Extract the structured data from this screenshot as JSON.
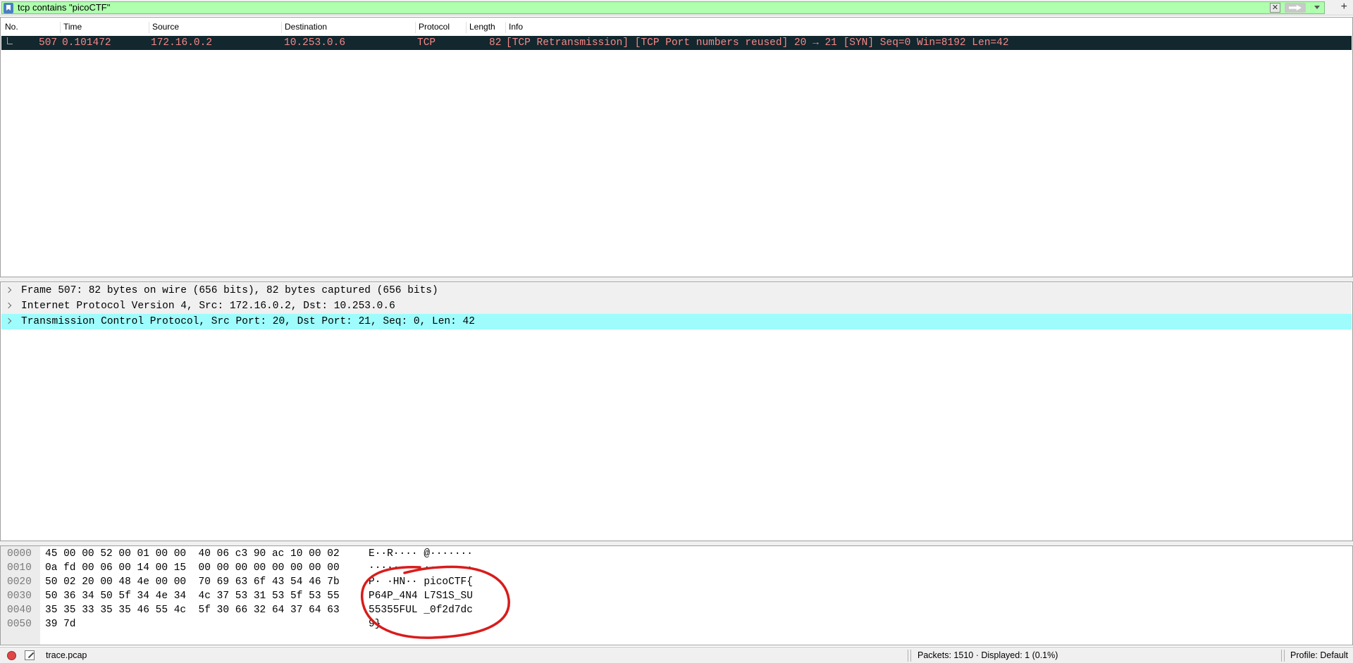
{
  "filter": {
    "value": "tcp contains \"picoCTF\"",
    "clear_symbol": "✕",
    "add_symbol": "+"
  },
  "packet_list": {
    "columns": [
      "No.",
      "Time",
      "Source",
      "Destination",
      "Protocol",
      "Length",
      "Info"
    ],
    "rows": [
      {
        "no": "507",
        "time": "0.101472",
        "source": "172.16.0.2",
        "destination": "10.253.0.6",
        "protocol": "TCP",
        "length": "82",
        "info": "[TCP Retransmission] [TCP Port numbers reused] 20 → 21 [SYN] Seq=0 Win=8192 Len=42"
      }
    ]
  },
  "details": {
    "items": [
      "Frame 507: 82 bytes on wire (656 bits), 82 bytes captured (656 bits)",
      "Internet Protocol Version 4, Src: 172.16.0.2, Dst: 10.253.0.6",
      "Transmission Control Protocol, Src Port: 20, Dst Port: 21, Seq: 0, Len: 42"
    ],
    "selected_index": 2
  },
  "bytes": {
    "rows": [
      {
        "offset": "0000",
        "hex": "45 00 00 52 00 01 00 00  40 06 c3 90 ac 10 00 02",
        "ascii": "E··R···· @·······"
      },
      {
        "offset": "0010",
        "hex": "0a fd 00 06 00 14 00 15  00 00 00 00 00 00 00 00",
        "ascii": "········ ········"
      },
      {
        "offset": "0020",
        "hex": "50 02 20 00 48 4e 00 00  70 69 63 6f 43 54 46 7b",
        "ascii": "P· ·HN·· picoCTF{"
      },
      {
        "offset": "0030",
        "hex": "50 36 34 50 5f 34 4e 34  4c 37 53 31 53 5f 53 55",
        "ascii": "P64P_4N4 L7S1S_SU"
      },
      {
        "offset": "0040",
        "hex": "35 35 33 35 35 46 55 4c  5f 30 66 32 64 37 64 63",
        "ascii": "55355FUL _0f2d7dc"
      },
      {
        "offset": "0050",
        "hex": "39 7d",
        "ascii": "9}"
      }
    ]
  },
  "annotation": {
    "color": "#d81c1c"
  },
  "status": {
    "file": "trace.pcap",
    "packets": "Packets: 1510 · Displayed: 1 (0.1%)",
    "profile": "Profile: Default"
  },
  "colors": {
    "selected_row_bg": "#12272e",
    "selected_row_fg": "#f78787",
    "filter_valid_bg": "#afffaf",
    "selected_detail_bg": "#9efcfc"
  }
}
